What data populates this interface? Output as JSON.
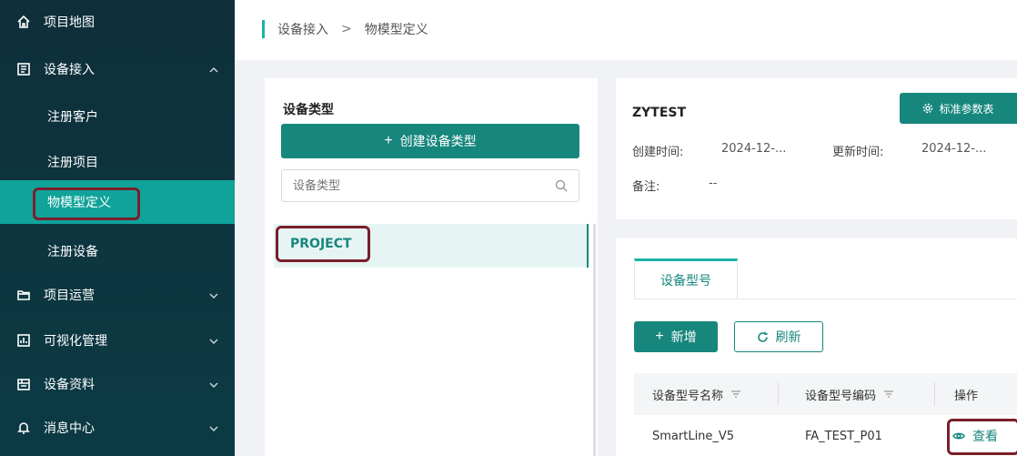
{
  "sidebar": {
    "items": [
      {
        "label": "项目地图",
        "icon": "home-icon"
      },
      {
        "label": "设备接入",
        "icon": "device-icon",
        "expanded": true
      },
      {
        "label": "项目运营",
        "icon": "folder-icon"
      },
      {
        "label": "可视化管理",
        "icon": "chart-icon"
      },
      {
        "label": "设备资料",
        "icon": "doc-icon"
      },
      {
        "label": "消息中心",
        "icon": "bell-icon"
      }
    ],
    "sub_items": [
      {
        "label": "注册客户"
      },
      {
        "label": "注册项目"
      },
      {
        "label": "物模型定义",
        "active": true
      },
      {
        "label": "注册设备"
      }
    ]
  },
  "breadcrumb": {
    "parent": "设备接入",
    "separator": ">",
    "current": "物模型定义"
  },
  "left_panel": {
    "title": "设备类型",
    "create_label": "创建设备类型",
    "search_placeholder": "设备类型",
    "types": [
      {
        "label": "PROJECT",
        "selected": true
      }
    ]
  },
  "info": {
    "name": "ZYTEST",
    "std_button": "标准参数表",
    "created_label": "创建时间:",
    "created_value": "2024-12-...",
    "updated_label": "更新时间:",
    "updated_value": "2024-12-...",
    "remark_label": "备注:",
    "remark_value": "--"
  },
  "models": {
    "tab_label": "设备型号",
    "add_label": "新增",
    "refresh_label": "刷新",
    "columns": [
      "设备型号名称",
      "设备型号编码",
      "操作"
    ],
    "rows": [
      {
        "name": "SmartLine_V5",
        "code": "FA_TEST_P01",
        "action": "查看"
      }
    ]
  },
  "colors": {
    "accent": "#17877d",
    "accent_light": "#19b3a6",
    "sidebar_bg": "#0f2f3a",
    "active_bg": "#0fa39a",
    "highlight_box": "#7a1f2b"
  }
}
